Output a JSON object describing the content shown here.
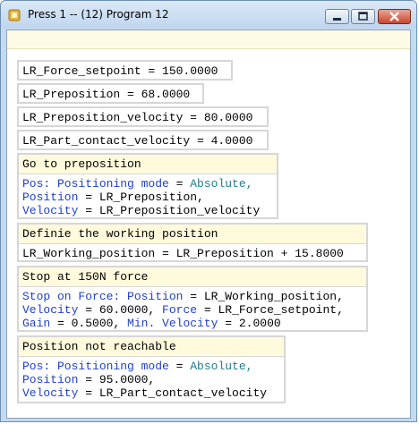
{
  "window": {
    "title": "Press 1 -- (12) Program 12"
  },
  "colors": {
    "keyword": "#1f3fcc",
    "enum_value": "#1d7e8e",
    "header_bg": "#fffadc"
  },
  "assignments": [
    "LR_Force_setpoint = 150.0000",
    "LR_Preposition = 68.0000",
    "LR_Preposition_velocity = 80.0000",
    "LR_Part_contact_velocity = 4.0000"
  ],
  "blocks": {
    "goto": {
      "header": "Go to preposition",
      "l1_kw": "Pos: Positioning mode",
      "l1_eq": " = ",
      "l1_val": "Absolute,",
      "l2_kw": "Position",
      "l2_rest": " = LR_Preposition,",
      "l3_kw": "Velocity",
      "l3_rest": " = LR_Preposition_velocity"
    },
    "working": {
      "header": "Definie the working position",
      "l1": "LR_Working_position = LR_Preposition + 15.8000"
    },
    "stop": {
      "header": "Stop at 150N force",
      "l1_kw1": "Stop on Force: Position",
      "l1_rest": " = LR_Working_position,",
      "l2_kw1": "Velocity",
      "l2_mid": " = 60.0000, ",
      "l2_kw2": "Force",
      "l2_rest": " = LR_Force_setpoint,",
      "l3_kw1": "Gain",
      "l3_mid": " = 0.5000, ",
      "l3_kw2": "Min. Velocity",
      "l3_rest": " = 2.0000"
    },
    "notreach": {
      "header": "Position not reachable",
      "l1_kw": "Pos: Positioning mode",
      "l1_eq": " = ",
      "l1_val": "Absolute,",
      "l2_kw": "Position",
      "l2_rest": " = 95.0000,",
      "l3_kw": "Velocity",
      "l3_rest": " = LR_Part_contact_velocity"
    }
  }
}
